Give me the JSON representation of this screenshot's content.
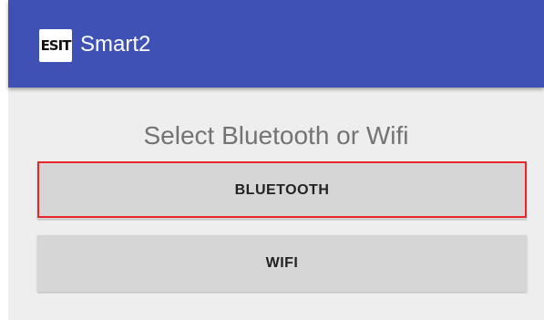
{
  "app_bar": {
    "logo_text": "ESIT",
    "title": "Smart2",
    "color": "#3f51b5"
  },
  "main": {
    "headline": "Select Bluetooth or Wifi",
    "buttons": [
      {
        "label": "BLUETOOTH",
        "highlighted": true
      },
      {
        "label": "WIFI",
        "highlighted": false
      }
    ]
  },
  "colors": {
    "background": "#eeeeee",
    "button": "#d6d6d6",
    "highlight": "#e8262b"
  }
}
